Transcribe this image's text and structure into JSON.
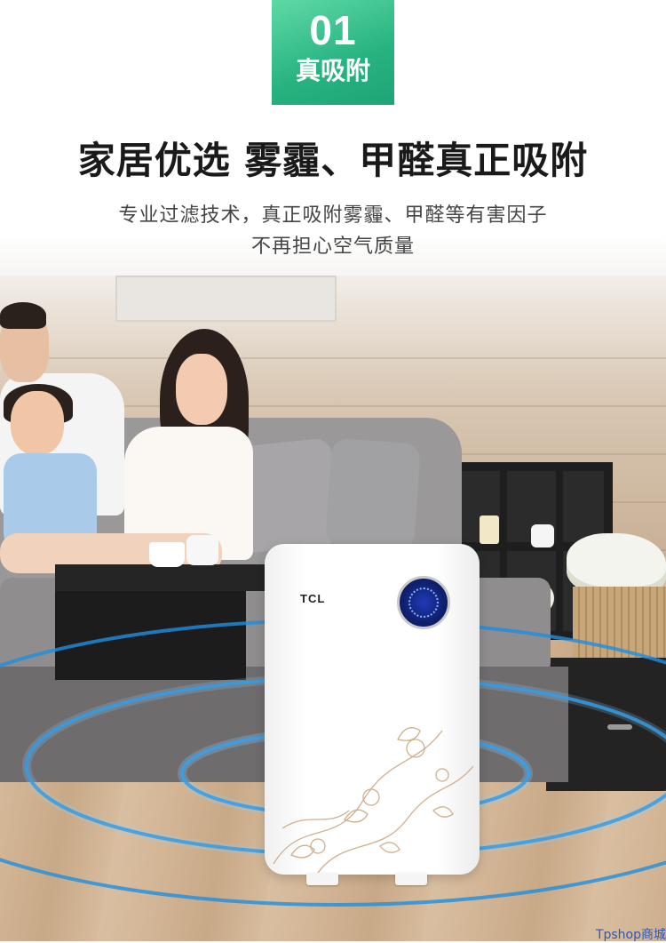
{
  "badge": {
    "number": "01",
    "title": "真吸附"
  },
  "headline": "家居优选 雾霾、甲醛真正吸附",
  "subtitle": {
    "line1": "专业过滤技术，真正吸附雾霾、甲醛等有害因子",
    "line2": "不再担心空气质量"
  },
  "product": {
    "brand": "TCL",
    "icon": "air-purifier-icon"
  },
  "watermark": "Tpshop商城",
  "colors": {
    "badge_green": "#27b380",
    "ring_blue": "#1e8fe0",
    "headline_text": "#1a1a1a",
    "watermark_blue": "#2e57b5"
  }
}
